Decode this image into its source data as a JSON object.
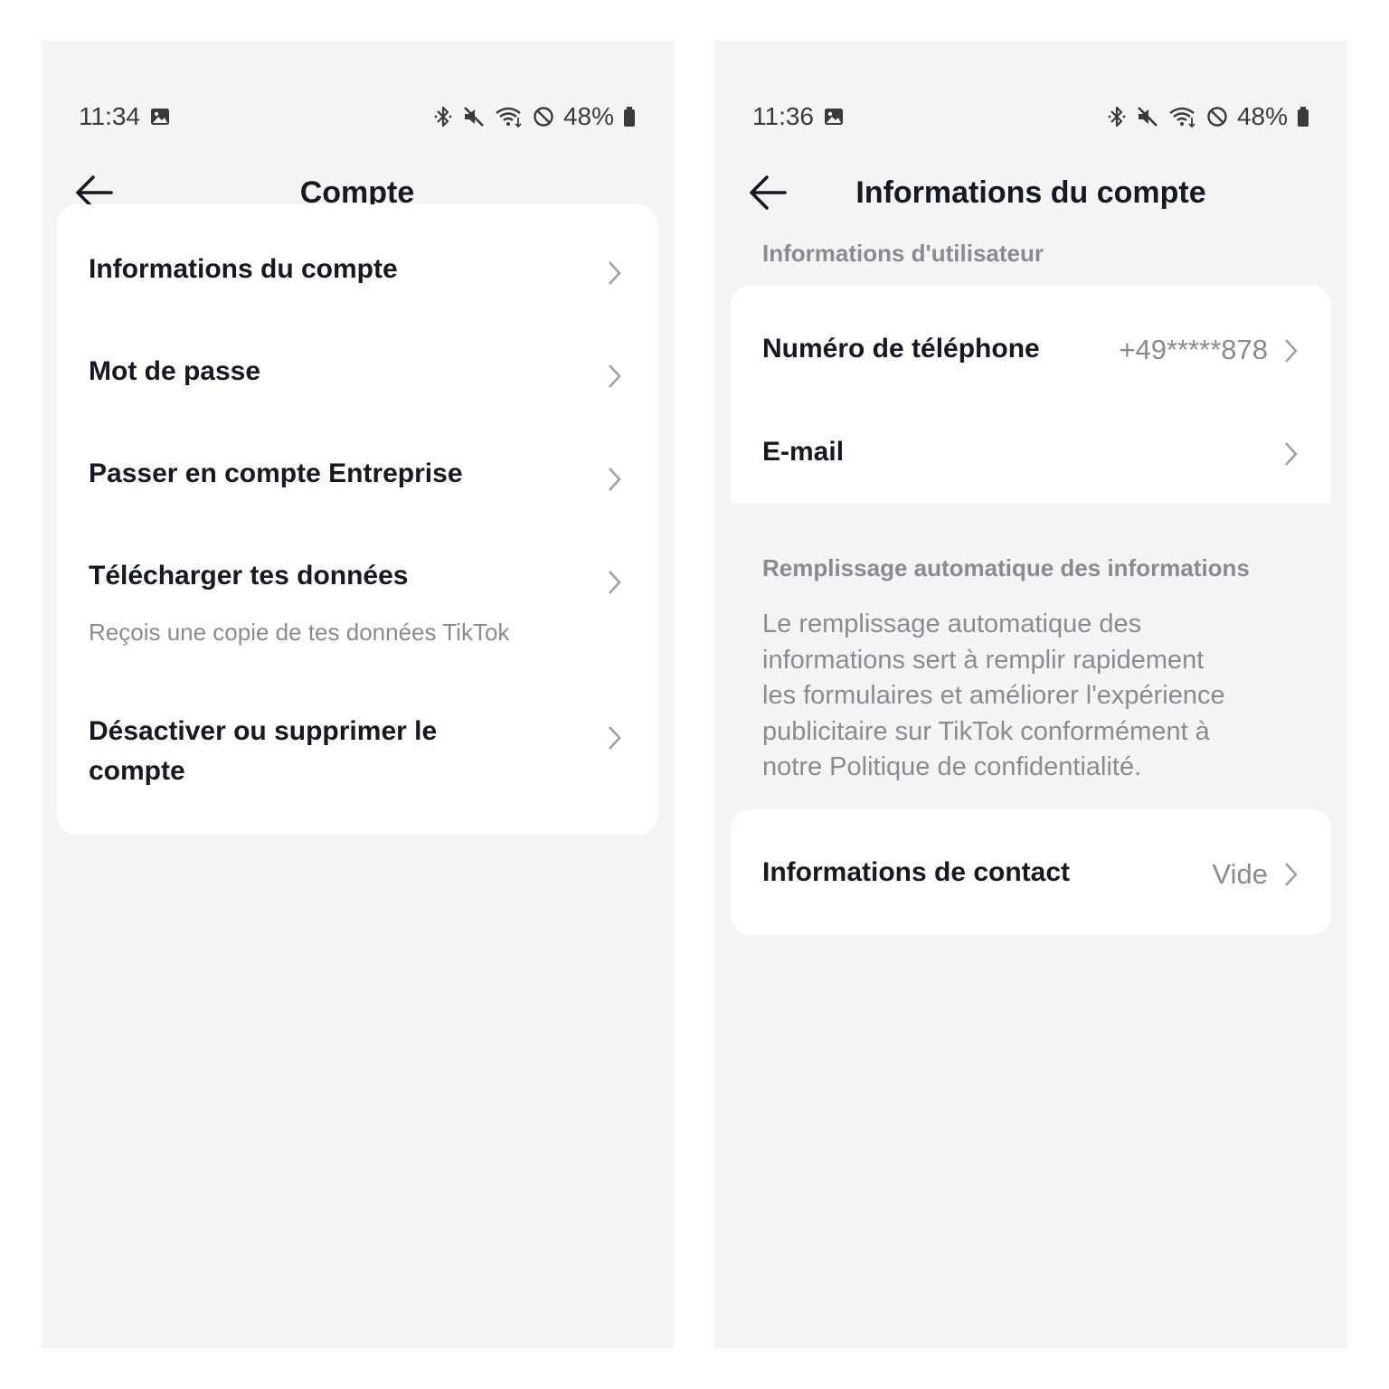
{
  "left_screen": {
    "status": {
      "time": "11:34",
      "battery": "48%",
      "icons": [
        "gallery-icon",
        "bluetooth-icon",
        "mute-icon",
        "wifi-icon",
        "do-not-disturb-icon",
        "battery-icon"
      ]
    },
    "header": {
      "title": "Compte",
      "back_icon": "arrow-left-icon"
    },
    "menu": {
      "items": [
        {
          "label": "Informations du compte"
        },
        {
          "label": "Mot de passe"
        },
        {
          "label": "Passer en compte Entreprise"
        },
        {
          "label": "Télécharger tes données",
          "subtitle": "Reçois une copie de tes données TikTok"
        },
        {
          "label_line1": "Désactiver ou supprimer le",
          "label_line2": "compte"
        }
      ]
    }
  },
  "right_screen": {
    "status": {
      "time": "11:36",
      "battery": "48%",
      "icons": [
        "gallery-icon",
        "bluetooth-icon",
        "mute-icon",
        "wifi-icon",
        "do-not-disturb-icon",
        "battery-icon"
      ]
    },
    "header": {
      "title": "Informations du compte",
      "back_icon": "arrow-left-icon"
    },
    "user_info": {
      "section_title": "Informations d'utilisateur",
      "phone": {
        "label": "Numéro de téléphone",
        "value": "+49*****878"
      },
      "email": {
        "label": "E-mail",
        "value": ""
      }
    },
    "autofill": {
      "section_title": "Remplissage automatique des informations",
      "description_lines": [
        "Le remplissage automatique des",
        "informations sert à remplir rapidement",
        "les formulaires et améliorer l'expérience",
        "publicitaire sur TikTok conformément à",
        "notre Politique de confidentialité."
      ],
      "contact": {
        "label": "Informations de contact",
        "value": "Vide"
      }
    }
  },
  "colors": {
    "screen_background": "#f4f4f4",
    "card_background": "#ffffff",
    "primary_text": "#161823",
    "secondary_text": "#8a8b91",
    "chevron": "#a0a1a6"
  }
}
